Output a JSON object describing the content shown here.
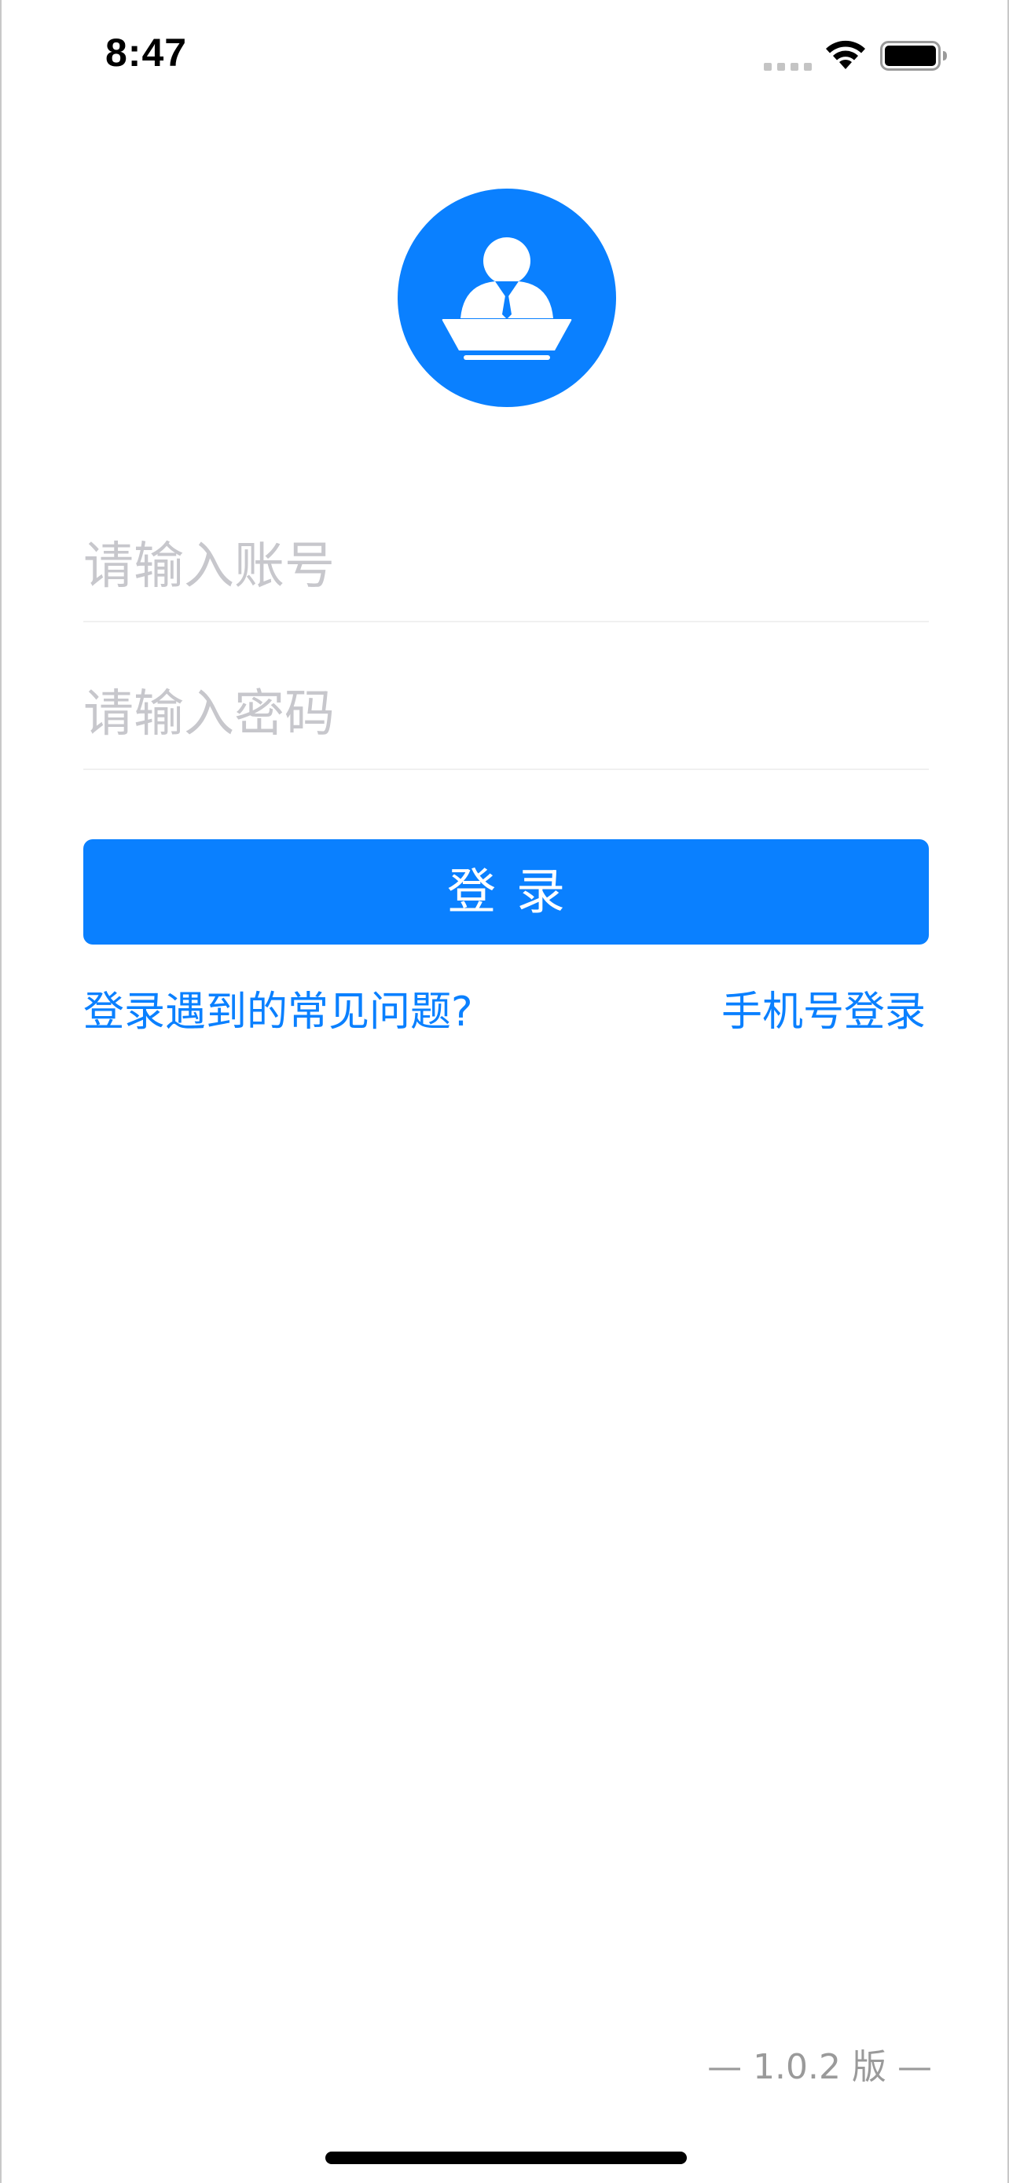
{
  "status_bar": {
    "time": "8:47",
    "icons": [
      "signal-icon",
      "wifi-icon",
      "battery-icon"
    ]
  },
  "logo": {
    "icon": "speaker-at-podium-icon",
    "background_color": "#0a80ff"
  },
  "form": {
    "account_placeholder": "请输入账号",
    "account_value": "",
    "password_placeholder": "请输入密码",
    "password_value": "",
    "login_label": "登录"
  },
  "links": {
    "faq_label": "登录遇到的常见问题?",
    "phone_login_label": "手机号登录"
  },
  "footer": {
    "version_label": "— 1.0.2 版 —"
  },
  "colors": {
    "accent": "#0a80ff",
    "placeholder": "#c7c7cc",
    "version_text": "#9a9a9a"
  }
}
